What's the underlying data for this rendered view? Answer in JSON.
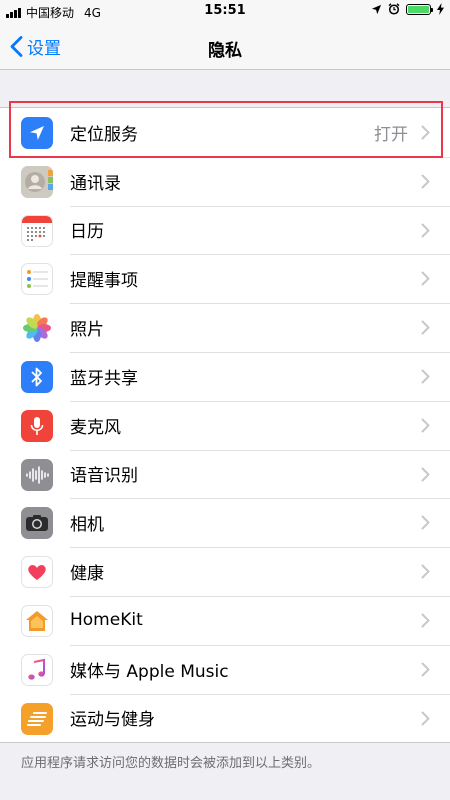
{
  "status_bar": {
    "carrier": "中国移动",
    "network": "4G",
    "time": "15:51",
    "battery_color": "#4cd964"
  },
  "nav": {
    "back_label": "设置",
    "title": "隐私",
    "accent": "#007aff"
  },
  "rows": [
    {
      "label": "定位服务",
      "value": "打开",
      "icon": "location-arrow-icon"
    },
    {
      "label": "通讯录",
      "icon": "contacts-icon"
    },
    {
      "label": "日历",
      "icon": "calendar-icon"
    },
    {
      "label": "提醒事项",
      "icon": "reminders-icon"
    },
    {
      "label": "照片",
      "icon": "photos-icon"
    },
    {
      "label": "蓝牙共享",
      "icon": "bluetooth-icon"
    },
    {
      "label": "麦克风",
      "icon": "microphone-icon"
    },
    {
      "label": "语音识别",
      "icon": "speech-recognition-icon"
    },
    {
      "label": "相机",
      "icon": "camera-icon"
    },
    {
      "label": "健康",
      "icon": "health-icon"
    },
    {
      "label": "HomeKit",
      "icon": "homekit-icon"
    },
    {
      "label": "媒体与 Apple Music",
      "icon": "music-icon"
    },
    {
      "label": "运动与健身",
      "icon": "motion-fitness-icon"
    }
  ],
  "footer": {
    "note": "应用程序请求访问您的数据时会被添加到以上类别。"
  },
  "highlight_color": "#e8384a"
}
